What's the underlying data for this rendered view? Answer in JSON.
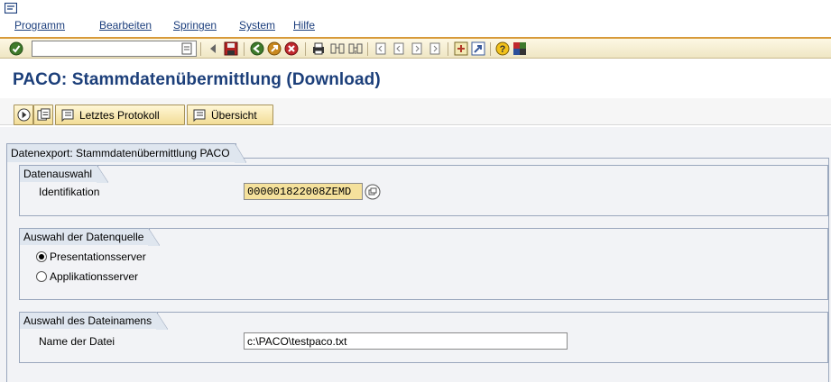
{
  "menu": {
    "items": [
      "Programm",
      "Bearbeiten",
      "Springen",
      "System",
      "Hilfe"
    ]
  },
  "toolbar": {
    "icons": [
      "enter-icon",
      "command-dropdown-icon",
      "back-arrow-icon",
      "save-icon",
      "back-icon",
      "exit-icon",
      "cancel-icon",
      "print-icon",
      "find-icon",
      "find-next-icon",
      "first-page-icon",
      "previous-page-icon",
      "next-page-icon",
      "last-page-icon",
      "new-session-icon",
      "shortcut-icon",
      "help-icon",
      "layout-menu-icon"
    ]
  },
  "title": "PACO: Stammdatenübermittlung (Download)",
  "app_toolbar": {
    "execute_icon": "execute-icon",
    "variant_icon": "get-variant-icon",
    "btn_letztes": "Letztes Protokoll",
    "btn_uebersicht": "Übersicht"
  },
  "main": {
    "frame_title": "Datenexport: Stammdatenübermittlung PACO",
    "datenauswahl": {
      "title": "Datenauswahl",
      "identifikation_label": "Identifikation",
      "identifikation_value": "000001822008ZEMD"
    },
    "datenquelle": {
      "title": "Auswahl der Datenquelle",
      "presentation_label": "Presentationsserver",
      "applikation_label": "Applikationsserver",
      "selected": "Presentationsserver"
    },
    "dateiname": {
      "title": "Auswahl des Dateinamens",
      "name_label": "Name der Datei",
      "name_value": "c:\\PACO\\testpaco.txt"
    }
  },
  "colors": {
    "title": "#1c3f7a",
    "toolbar_accent": "#d89a3a",
    "button_bg": "#f2dc96",
    "group_border": "#9aa7bd"
  }
}
